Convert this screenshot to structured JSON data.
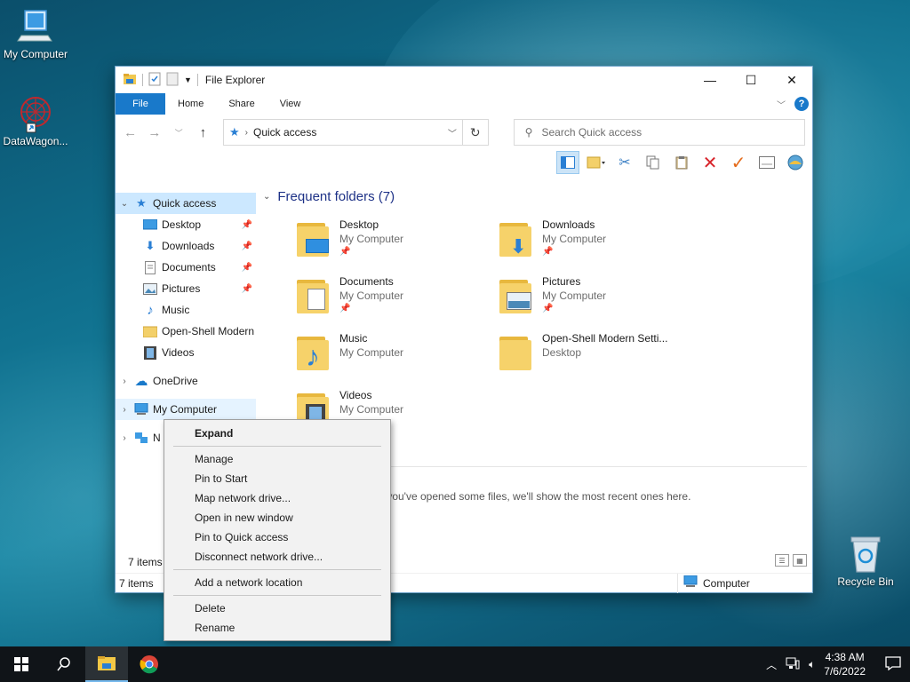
{
  "desktop": {
    "icons": [
      {
        "label": "My Computer"
      },
      {
        "label": "DataWagon..."
      },
      {
        "label": "Recycle Bin"
      }
    ]
  },
  "window": {
    "title": "File Explorer",
    "ribbon_tabs": [
      "File",
      "Home",
      "Share",
      "View"
    ],
    "help": "?",
    "address": "Quick access",
    "search_placeholder": "Search Quick access"
  },
  "nav": {
    "quick_access": "Quick access",
    "items": [
      {
        "label": "Desktop",
        "pinned": true
      },
      {
        "label": "Downloads",
        "pinned": true
      },
      {
        "label": "Documents",
        "pinned": true
      },
      {
        "label": "Pictures",
        "pinned": true
      },
      {
        "label": "Music",
        "pinned": false
      },
      {
        "label": "Open-Shell Modern",
        "pinned": false
      },
      {
        "label": "Videos",
        "pinned": false
      }
    ],
    "onedrive": "OneDrive",
    "my_computer": "My Computer",
    "network_partial": "N"
  },
  "content": {
    "group_title": "Frequent folders (7)",
    "folders": [
      {
        "name": "Desktop",
        "location": "My Computer"
      },
      {
        "name": "Downloads",
        "location": "My Computer"
      },
      {
        "name": "Documents",
        "location": "My Computer"
      },
      {
        "name": "Pictures",
        "location": "My Computer"
      },
      {
        "name": "Music",
        "location": "My Computer"
      },
      {
        "name": "Open-Shell Modern Setti...",
        "location": "Desktop"
      },
      {
        "name": "Videos",
        "location": "My Computer"
      }
    ],
    "recent_text": "r you've opened some files, we'll show the most recent ones here.",
    "item_count_inner": "7 items"
  },
  "status": {
    "items": "7 items",
    "computer": "Computer"
  },
  "context_menu": {
    "items": [
      "Expand",
      "Manage",
      "Pin to Start",
      "Map network drive...",
      "Open in new window",
      "Pin to Quick access",
      "Disconnect network drive...",
      "Add a network location",
      "Delete",
      "Rename"
    ]
  },
  "taskbar": {
    "time": "4:38 AM",
    "date": "7/6/2022"
  }
}
